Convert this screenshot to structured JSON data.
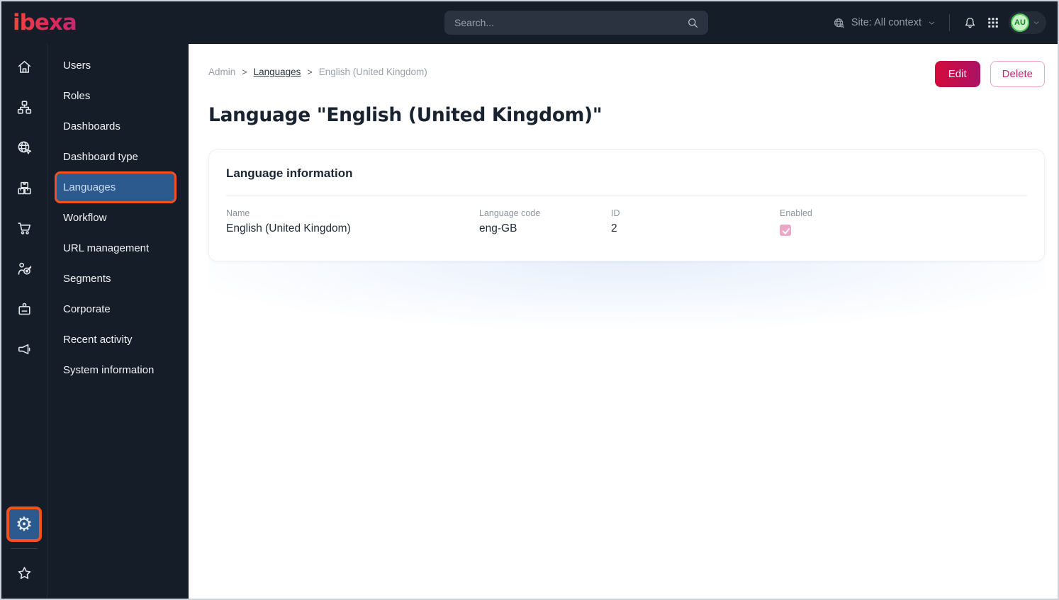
{
  "topbar": {
    "logo_text": "ibexa",
    "search_placeholder": "Search...",
    "site_context_label": "Site: All context",
    "avatar_initials": "AU"
  },
  "sidebar": {
    "items": [
      "Users",
      "Roles",
      "Dashboards",
      "Dashboard type",
      "Languages",
      "Workflow",
      "URL management",
      "Segments",
      "Corporate",
      "Recent activity",
      "System information"
    ],
    "active_item": "Languages"
  },
  "breadcrumb": {
    "items": [
      "Admin",
      "Languages",
      "English (United Kingdom)"
    ],
    "separator": ">"
  },
  "actions": {
    "edit_label": "Edit",
    "delete_label": "Delete"
  },
  "page": {
    "title": "Language \"English (United Kingdom)\""
  },
  "card": {
    "title": "Language information",
    "fields": [
      {
        "label": "Name",
        "value": "English (United Kingdom)"
      },
      {
        "label": "Language code",
        "value": "eng-GB"
      },
      {
        "label": "ID",
        "value": "2"
      },
      {
        "label": "Enabled",
        "value": "checked",
        "checked": true
      }
    ]
  },
  "icon_rail": {
    "items": [
      "home",
      "content-structure",
      "site",
      "product-catalog",
      "commerce",
      "customer-targeting",
      "corporate",
      "marketing"
    ],
    "bottom_items": [
      "admin-settings",
      "bookmarks"
    ],
    "active_bottom_item": "admin-settings"
  },
  "colors": {
    "topbar_bg": "#151d28",
    "active_blue": "#2d5a8e",
    "annotation_orange": "#f3501e",
    "primary_gradient_start": "#d40a3c",
    "primary_gradient_end": "#ab1264",
    "delete_pink": "#bc2a6d",
    "checkbox_pink": "#eba7c7"
  }
}
